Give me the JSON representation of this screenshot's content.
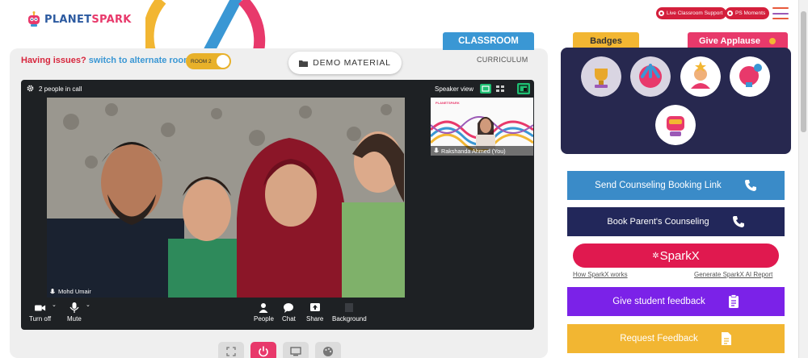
{
  "header": {
    "logo_part1": "PLANET",
    "logo_part2": "SPARK",
    "live_support_label": "Live Classroom Support",
    "ps_moments_label": "PS Moments"
  },
  "classroom": {
    "tab_classroom": "CLASSROOM",
    "tab_curriculum": "CURRICULUM",
    "issue_text": "Having issues?",
    "alt_room_link": "switch to alternate room",
    "room_toggle_label": "ROOM 2",
    "demo_material_label": "DEMO MATERIAL"
  },
  "call": {
    "people_count": "2 people in call",
    "speaker_view_label": "Speaker view",
    "main_participant": "Mohd Umair",
    "self_participant": "Rakshanda Ahmed (You)",
    "controls": {
      "camera": "Turn off",
      "mic": "Mute",
      "people": "People",
      "chat": "Chat",
      "share": "Share",
      "background": "Background"
    }
  },
  "right": {
    "tab_badges": "Badges",
    "tab_applause": "Give Applause",
    "badges": [
      "trophy-badge",
      "team-hands-badge",
      "superstar-badge",
      "lightbulb-badge",
      "robot-badge"
    ],
    "send_counseling": "Send Counseling Booking Link",
    "book_parent": "Book Parent's Counseling",
    "sparkx": "SparkX",
    "how_sparkx": "How SparkX works",
    "generate_report": "Generate SparkX AI Report",
    "student_feedback": "Give student feedback",
    "request_feedback": "Request Feedback"
  },
  "colors": {
    "classroom_tab": "#3a97d4",
    "badges_tab": "#f2b632",
    "applause_tab": "#e8396b",
    "badges_panel": "#27284f",
    "send_counseling_btn": "#3a8bc8",
    "book_parent_btn": "#22275a",
    "sparkx_btn": "#e0194f",
    "student_feedback_btn": "#7b22e8",
    "request_feedback_btn": "#f2b632"
  }
}
